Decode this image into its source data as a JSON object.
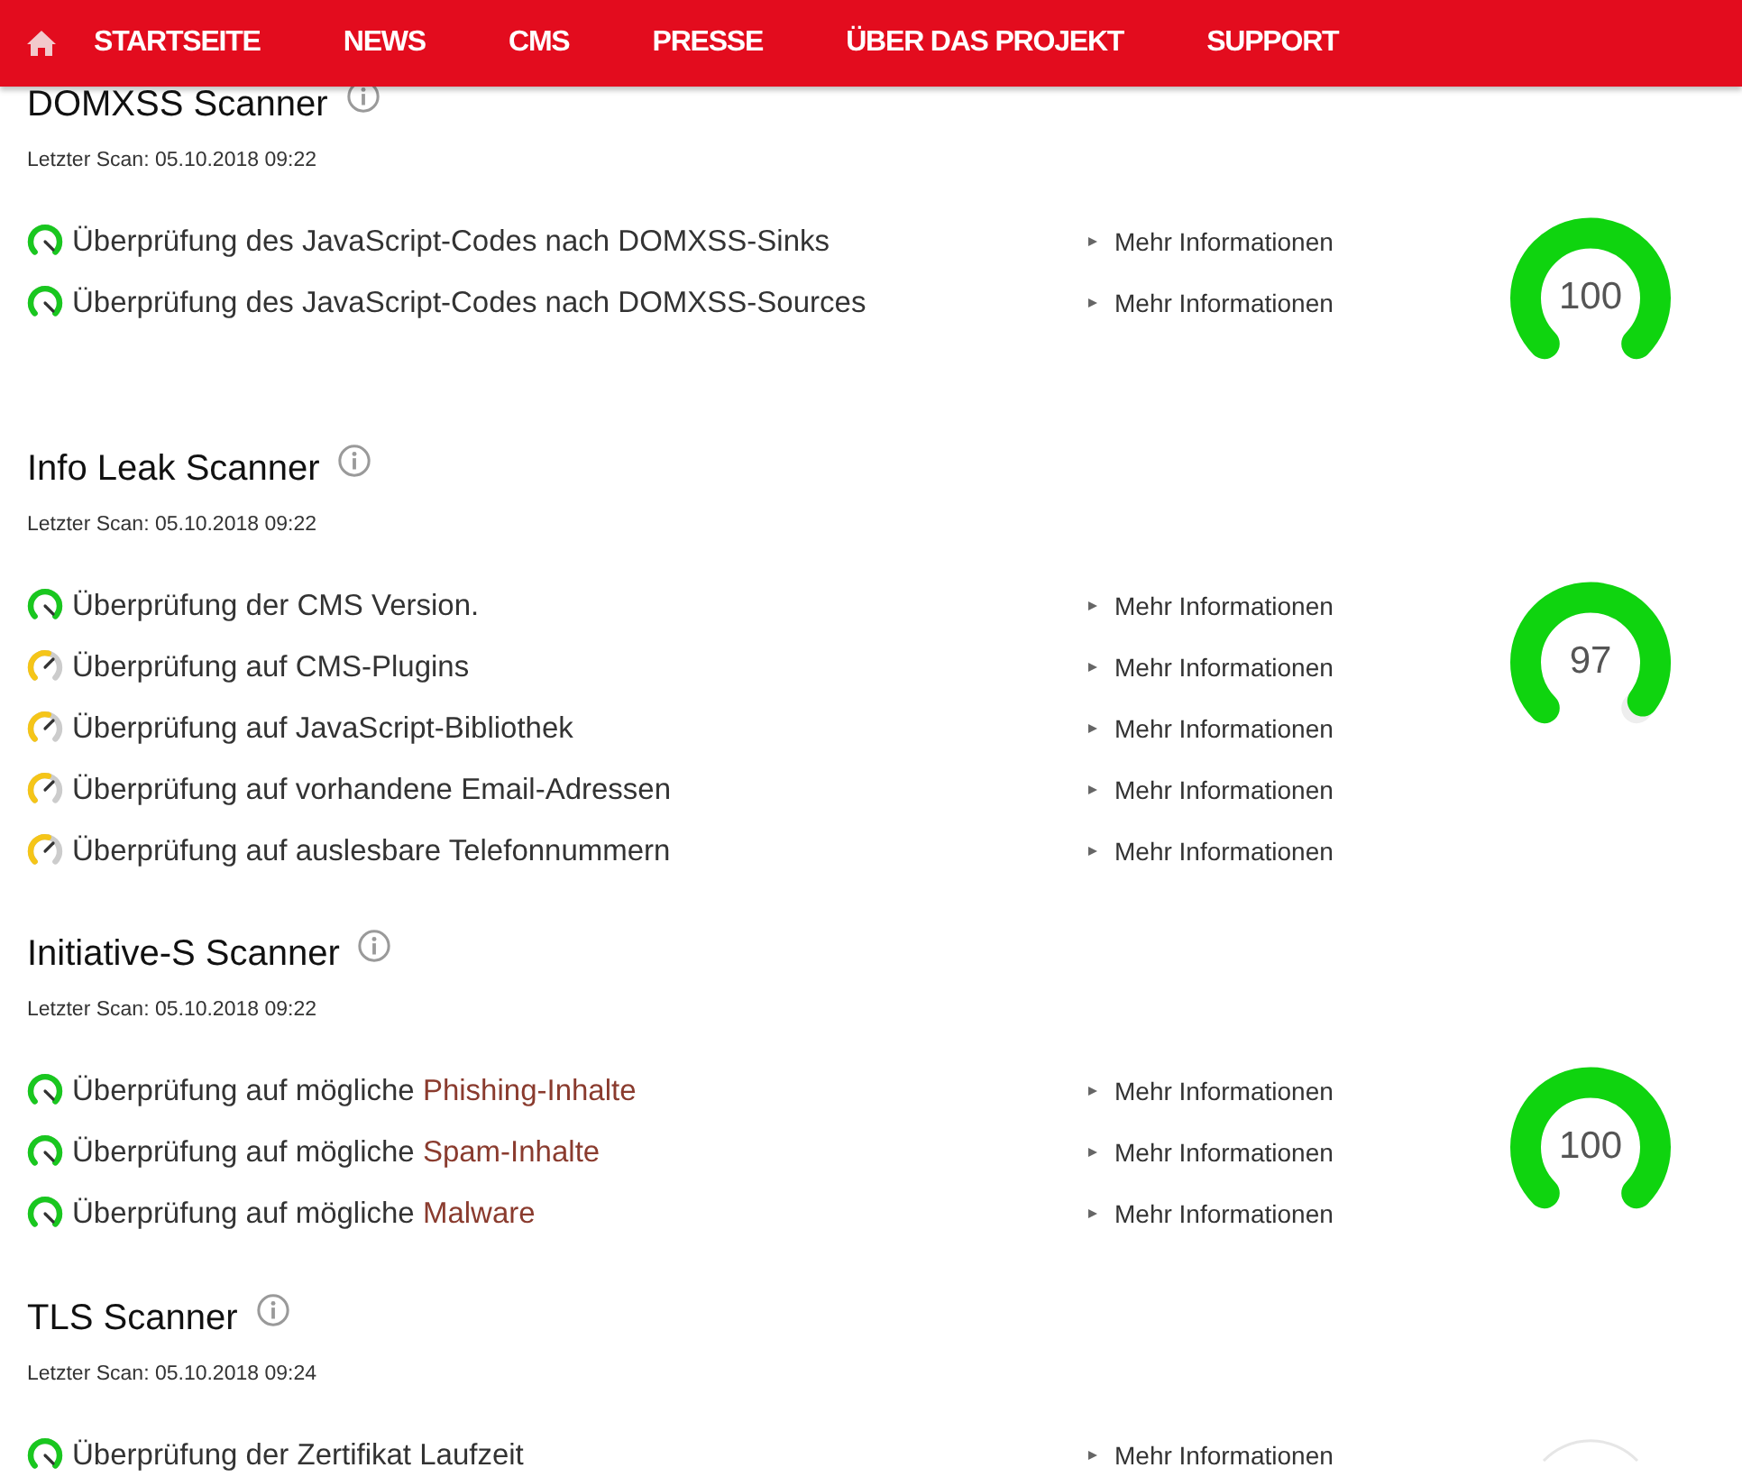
{
  "nav": {
    "items": [
      "STARTSEITE",
      "NEWS",
      "CMS",
      "PRESSE",
      "ÜBER DAS PROJEKT",
      "SUPPORT"
    ]
  },
  "scanners": [
    {
      "title": "DOMXSS Scanner",
      "last_scan": "Letzter Scan: 05.10.2018 09:22",
      "gauge": {
        "score": "100",
        "level": 1
      },
      "checks": [
        {
          "kind": "pass",
          "text": "Überprüfung des JavaScript-Codes nach DOMXSS-Sinks",
          "link": "Mehr Informationen"
        },
        {
          "kind": "pass",
          "text": "Überprüfung des JavaScript-Codes nach DOMXSS-Sources",
          "link": "Mehr Informationen"
        }
      ]
    },
    {
      "title": "Info Leak Scanner",
      "last_scan": "Letzter Scan: 05.10.2018 09:22",
      "gauge": {
        "score": "97",
        "level": 0.97
      },
      "checks": [
        {
          "kind": "pass",
          "text": "Überprüfung der CMS Version.",
          "link": "Mehr Informationen"
        },
        {
          "kind": "warning",
          "text": "Überprüfung auf CMS-Plugins",
          "link": "Mehr Informationen"
        },
        {
          "kind": "warning",
          "text": "Überprüfung auf JavaScript-Bibliothek",
          "link": "Mehr Informationen"
        },
        {
          "kind": "warning",
          "text": "Überprüfung auf vorhandene Email-Adressen",
          "link": "Mehr Informationen"
        },
        {
          "kind": "warning",
          "text": "Überprüfung auf auslesbare Telefonnummern",
          "link": "Mehr Informationen"
        }
      ]
    },
    {
      "title": "Initiative-S Scanner",
      "last_scan": "Letzter Scan: 05.10.2018 09:22",
      "gauge": {
        "score": "100",
        "level": 1
      },
      "checks": [
        {
          "kind": "pass",
          "text": "Überprüfung auf mögliche",
          "highlight": "Phishing-Inhalte",
          "link": "Mehr Informationen"
        },
        {
          "kind": "pass",
          "text": "Überprüfung auf mögliche",
          "highlight": "Spam-Inhalte",
          "link": "Mehr Informationen"
        },
        {
          "kind": "pass",
          "text": "Überprüfung auf mögliche",
          "highlight": "Malware",
          "link": "Mehr Informationen"
        }
      ]
    },
    {
      "title": "TLS Scanner",
      "last_scan": "Letzter Scan: 05.10.2018 09:24",
      "checks": [
        {
          "kind": "pass",
          "text": "Überprüfung der Zertifikat Laufzeit",
          "link": "Mehr Informationen"
        }
      ]
    }
  ]
}
